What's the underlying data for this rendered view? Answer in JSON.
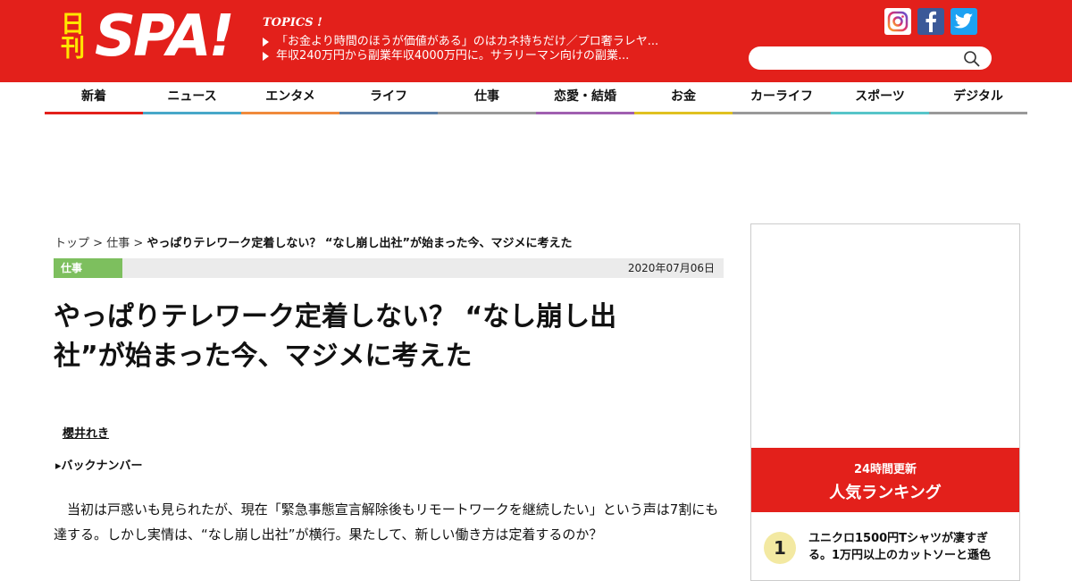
{
  "header": {
    "logo": {
      "nikkan": "日刊",
      "spa": "SPA!"
    },
    "topics_title": "TOPICS !",
    "topics": [
      "「お金より時間のほうが価値がある」のはカネ持ちだけ／プロ奢ラレヤ...",
      "年収240万円から副業年収4000万円に。サラリーマン向けの副業..."
    ],
    "social": [
      {
        "name": "instagram-icon",
        "color": "#ffffff"
      },
      {
        "name": "facebook-icon",
        "color": "#3b5998"
      },
      {
        "name": "twitter-icon",
        "color": "#1da1f2"
      }
    ],
    "search_placeholder": ""
  },
  "colors": {
    "brand": "#e3201b",
    "logo_accent": "#ffe600",
    "category": "#7dbf5e"
  },
  "nav": [
    {
      "label": "新着",
      "color": "#e3201b"
    },
    {
      "label": "ニュース",
      "color": "#48a8c9"
    },
    {
      "label": "エンタメ",
      "color": "#f08a3c"
    },
    {
      "label": "ライフ",
      "color": "#5b7fa8"
    },
    {
      "label": "仕事",
      "color": "#999999"
    },
    {
      "label": "恋愛・結婚",
      "color": "#a05fb0"
    },
    {
      "label": "お金",
      "color": "#e0c120"
    },
    {
      "label": "カーライフ",
      "color": "#999999"
    },
    {
      "label": "スポーツ",
      "color": "#57c5c9"
    },
    {
      "label": "デジタル",
      "color": "#999999"
    }
  ],
  "breadcrumb": {
    "home": "トップ",
    "sep1": " > ",
    "category": "仕事",
    "sep2": " > ",
    "current": "やっぱりテレワーク定着しない？ “なし崩し出社”が始まった今、マジメに考えた"
  },
  "article": {
    "category": "仕事",
    "date": "2020年07月06日",
    "title_line1": "やっぱりテレワーク定着しない？ “なし崩し出",
    "title_line2": "社”が始まった今、マジメに考えた",
    "author": "櫻井れき",
    "backnumber": "▸バックナンバー",
    "lead": "当初は戸惑いも見られたが、現在「緊急事態宣言解除後もリモートワークを継続したい」という声は7割にも達する。しかし実情は、“なし崩し出社”が横行。果たして、新しい働き方は定着するのか？"
  },
  "ranking": {
    "subtitle": "24時間更新",
    "title": "人気ランキング",
    "items": [
      {
        "rank": "1",
        "text": "ユニクロ1500円Tシャツが凄すぎる。1万円以上のカットソーと遜色"
      }
    ]
  }
}
